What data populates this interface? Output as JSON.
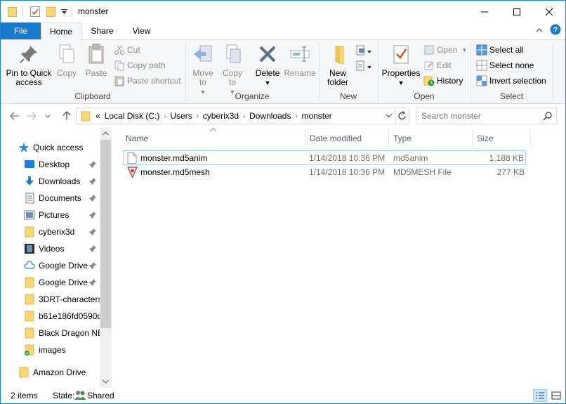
{
  "window": {
    "title": "monster"
  },
  "ribbon_tabs": [
    "File",
    "Home",
    "Share",
    "View"
  ],
  "ribbon": {
    "clipboard": {
      "label": "Clipboard",
      "pin": "Pin to Quick access",
      "copy": "Copy",
      "paste": "Paste",
      "cut": "Cut",
      "copy_path": "Copy path",
      "paste_shortcut": "Paste shortcut"
    },
    "organize": {
      "label": "Organize",
      "move_to": "Move to",
      "copy_to": "Copy to",
      "delete": "Delete",
      "rename": "Rename"
    },
    "new": {
      "label": "New",
      "new_folder": "New folder"
    },
    "open": {
      "label": "Open",
      "properties": "Properties",
      "open": "Open",
      "edit": "Edit",
      "history": "History"
    },
    "select": {
      "label": "Select",
      "select_all": "Select all",
      "select_none": "Select none",
      "invert_selection": "Invert selection"
    }
  },
  "address": {
    "overflow": "«",
    "crumbs": [
      "Local Disk (C:)",
      "Users",
      "cyberix3d",
      "Downloads",
      "monster"
    ]
  },
  "search": {
    "placeholder": "Search monster"
  },
  "nav": {
    "items": [
      {
        "label": "Quick access",
        "icon": "star-icon"
      },
      {
        "label": "Desktop",
        "icon": "desktop-icon",
        "pinned": true
      },
      {
        "label": "Downloads",
        "icon": "download-icon",
        "pinned": true
      },
      {
        "label": "Documents",
        "icon": "documents-icon",
        "pinned": true
      },
      {
        "label": "Pictures",
        "icon": "pictures-icon",
        "pinned": true
      },
      {
        "label": "cyberix3d",
        "icon": "folder-icon",
        "pinned": true
      },
      {
        "label": "Videos",
        "icon": "videos-icon",
        "pinned": true
      },
      {
        "label": "Google Drive",
        "icon": "cloud-icon",
        "pinned": true
      },
      {
        "label": "Google Drive",
        "icon": "folder-icon",
        "pinned": true
      },
      {
        "label": "3DRT-characters",
        "icon": "folder-icon"
      },
      {
        "label": "b61e186fd0590d",
        "icon": "folder-icon"
      },
      {
        "label": "Black Dragon NE",
        "icon": "folder-icon"
      },
      {
        "label": "images",
        "icon": "folder-synced-icon"
      },
      {
        "label": "Amazon Drive",
        "icon": "folder-icon"
      }
    ]
  },
  "columns": {
    "name": "Name",
    "date": "Date modified",
    "type": "Type",
    "size": "Size"
  },
  "files": [
    {
      "name": "monster.md5anim",
      "date": "1/14/2018 10:36 PM",
      "type": "md5anim",
      "size": "1,188 KB",
      "icon": "blank-file-icon",
      "selected": true
    },
    {
      "name": "monster.md5mesh",
      "date": "1/14/2018 10:36 PM",
      "type": "MD5MESH File",
      "size": "277 KB",
      "icon": "md5mesh-file-icon",
      "selected": false
    }
  ],
  "status": {
    "count": "2 items",
    "state_label": "State:",
    "state_value": "Shared"
  },
  "colors": {
    "accent": "#1979ca",
    "folder": "#f8d775",
    "selection_border": "#99d1ff"
  }
}
